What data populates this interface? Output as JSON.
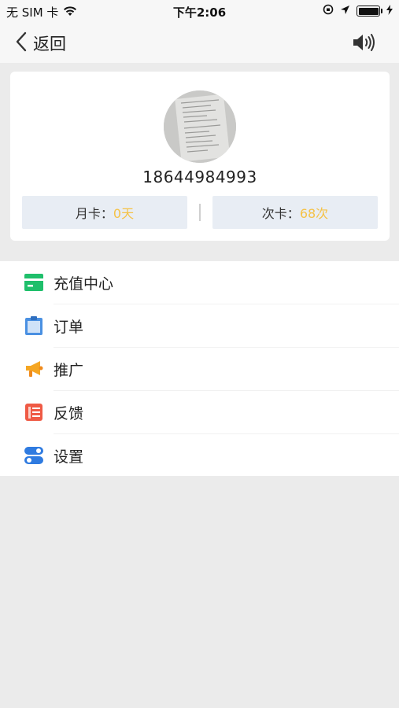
{
  "status_bar": {
    "carrier": "无 SIM 卡",
    "time": "下午2:06"
  },
  "nav": {
    "back_label": "返回"
  },
  "profile": {
    "phone": "18644984993",
    "month_card_label": "月卡：",
    "month_card_value": "0天",
    "times_card_label": "次卡：",
    "times_card_value": "68次"
  },
  "menu": {
    "items": [
      {
        "label": "充值中心",
        "icon": "recharge-card-icon"
      },
      {
        "label": "订单",
        "icon": "order-clipboard-icon"
      },
      {
        "label": "推广",
        "icon": "megaphone-icon"
      },
      {
        "label": "反馈",
        "icon": "feedback-notes-icon"
      },
      {
        "label": "设置",
        "icon": "settings-toggle-icon"
      }
    ]
  },
  "colors": {
    "accent_value": "#f5c247",
    "recharge_green": "#1fbf6b",
    "order_blue": "#4a90e2",
    "promo_orange": "#f5a623",
    "feedback_red": "#ef5a45",
    "settings_blue": "#2f7be0"
  }
}
